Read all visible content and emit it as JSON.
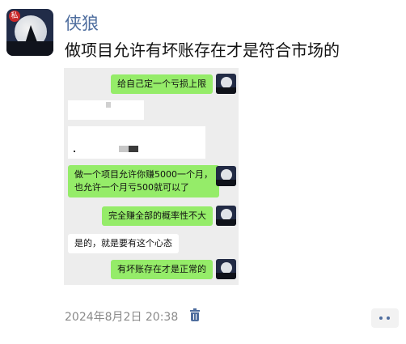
{
  "post": {
    "username": "侠狼",
    "avatar_seal": "私",
    "text": "做项目允许有坏账存在才是符合市场的",
    "timestamp": "2024年8月2日 20:38"
  },
  "chat": {
    "messages": [
      {
        "side": "right",
        "text": "给自己定一个亏损上限"
      },
      {
        "side": "right",
        "line1": "做一个项目允许你赚5000一个月，",
        "line2": "也允许一个月亏500就可以了"
      },
      {
        "side": "right",
        "text": "完全赚全部的概率性不大"
      },
      {
        "side": "left",
        "text": "是的，就是要有这个心态"
      },
      {
        "side": "right",
        "text": "有坏账存在才是正常的"
      }
    ]
  },
  "icons": {
    "trash": "trash-icon",
    "more": "more-dots-icon"
  },
  "colors": {
    "username": "#4e6d9e",
    "bubble_green": "#95ec69",
    "chat_bg": "#ededed"
  }
}
